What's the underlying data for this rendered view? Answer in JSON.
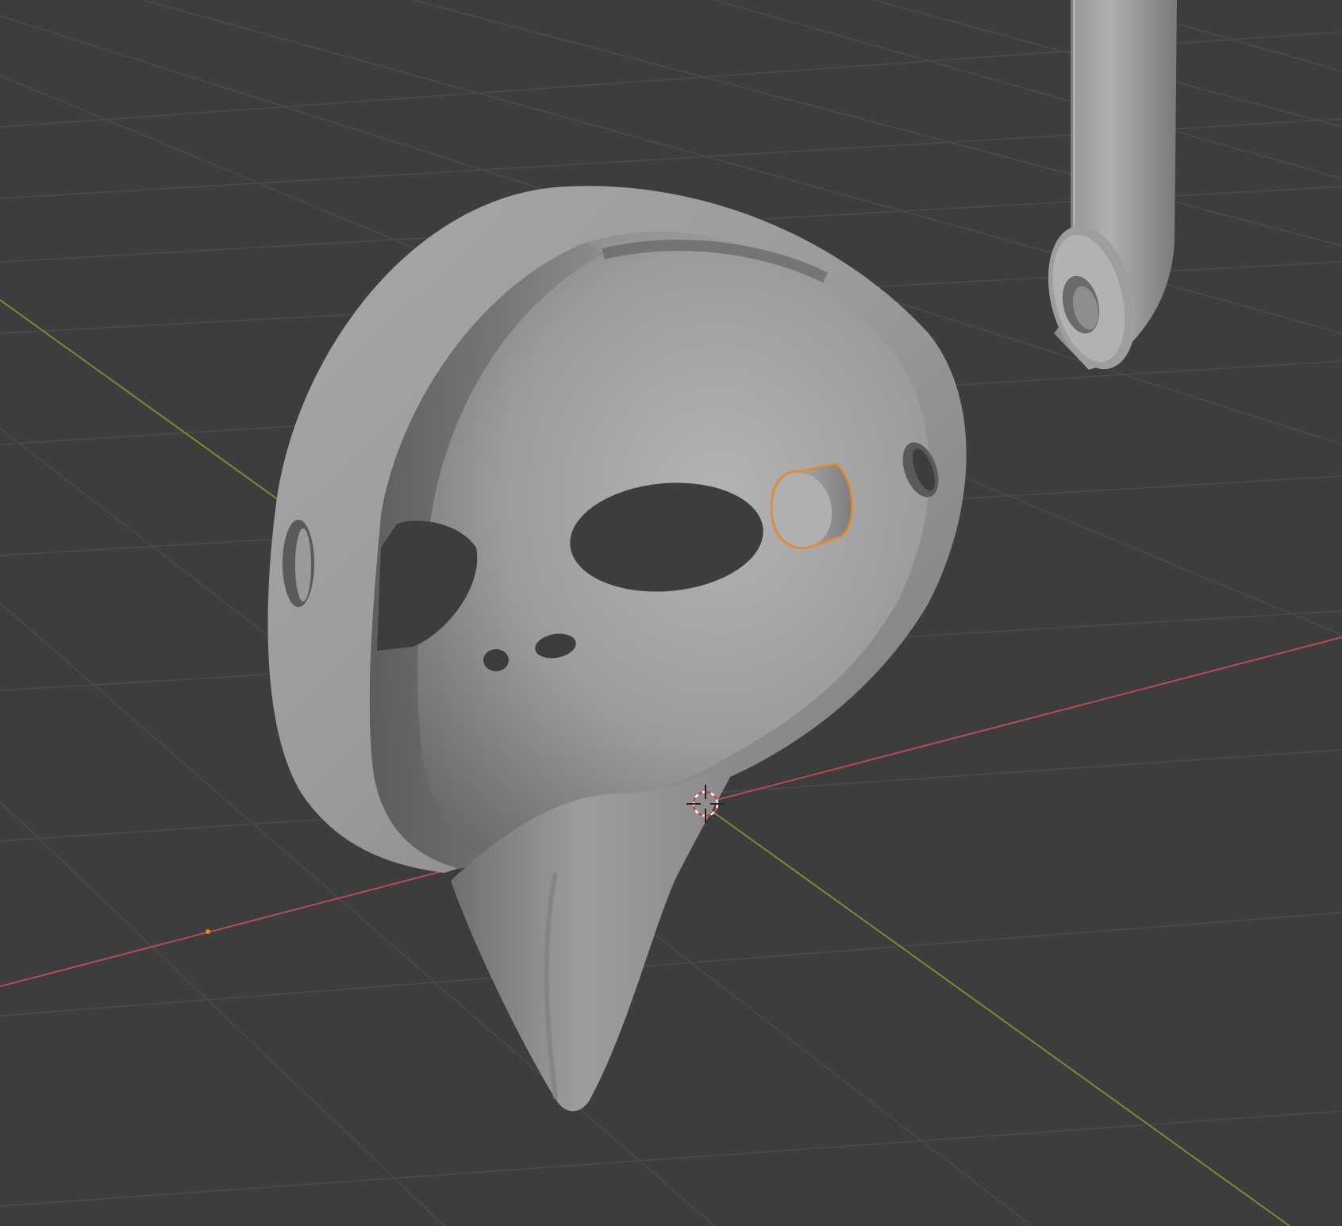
{
  "viewport": {
    "background": "#3d3d3d",
    "grid_color": "#4a4a4a",
    "axis_x_color": "#b84a57",
    "axis_y_color": "#6e9232",
    "selection_outline_color": "#e8882a",
    "object_color": "#9a9a9a"
  },
  "objects": [
    {
      "name": "mask",
      "selected": false
    },
    {
      "name": "hook-tube",
      "selected": false
    },
    {
      "name": "peg-cylinder",
      "selected": true
    }
  ],
  "cursor": {
    "icon": "3d-cursor-icon"
  }
}
